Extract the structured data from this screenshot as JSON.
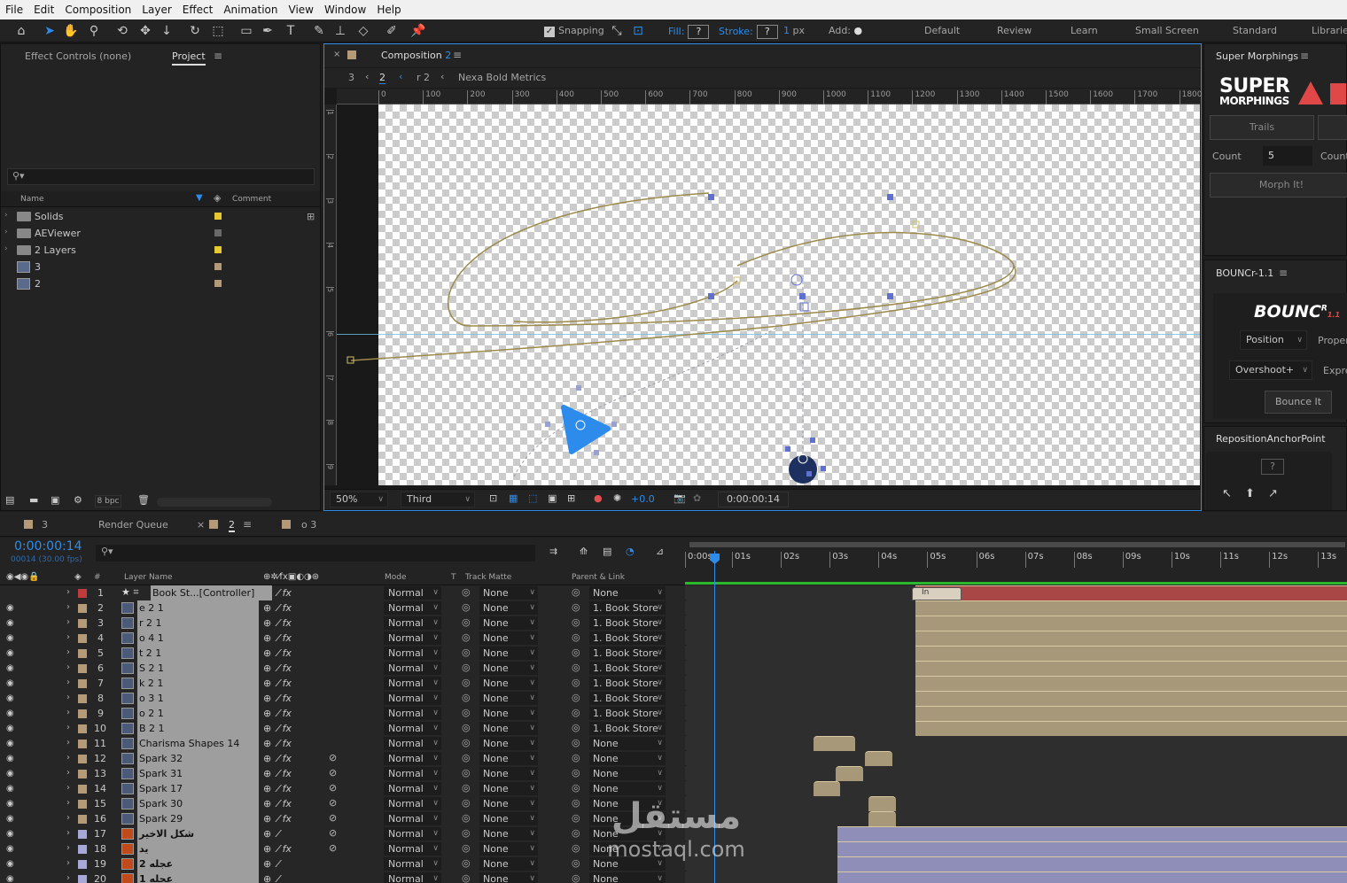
{
  "menu": [
    "File",
    "Edit",
    "Composition",
    "Layer",
    "Effect",
    "Animation",
    "View",
    "Window",
    "Help"
  ],
  "toolbar": {
    "snapping": "Snapping",
    "fill_label": "Fill:",
    "fill_value": "?",
    "stroke_label": "Stroke:",
    "stroke_value": "?",
    "stroke_width": "1",
    "stroke_unit": "px",
    "add_label": "Add:",
    "workspaces": [
      "Default",
      "Review",
      "Learn",
      "Small Screen",
      "Standard",
      "Libraries"
    ]
  },
  "project_panel": {
    "tab_effect_controls": "Effect Controls (none)",
    "tab_project": "Project",
    "col_name": "Name",
    "col_comment": "Comment",
    "items": [
      {
        "name": "Solids",
        "type": "folder",
        "label_color": "#e6c830"
      },
      {
        "name": "AEViewer",
        "type": "folder",
        "label_color": "#6a6a6a"
      },
      {
        "name": "2 Layers",
        "type": "folder",
        "label_color": "#e6c830"
      },
      {
        "name": "3",
        "type": "comp",
        "label_color": "#b59a78"
      },
      {
        "name": "2",
        "type": "comp",
        "label_color": "#b59a78"
      }
    ],
    "bpc": "8 bpc"
  },
  "composition": {
    "tab_label": "Composition",
    "tab_num": "2",
    "breadcrumbs": [
      "3",
      "2",
      "r 2",
      "Nexa Bold Metrics"
    ],
    "ruler_h": [
      "0",
      "100",
      "200",
      "300",
      "400",
      "500",
      "600",
      "700",
      "800",
      "900",
      "1000",
      "1100",
      "1200",
      "1300",
      "1400",
      "1500",
      "1600",
      "1700",
      "1800"
    ],
    "ruler_v": [
      "1",
      "2",
      "3",
      "4",
      "5",
      "6",
      "7",
      "8",
      "9"
    ],
    "zoom": "50%",
    "resolution": "Third",
    "exposure": "+0.0",
    "timecode": "0:00:00:14"
  },
  "super_morphings": {
    "title": "Super Morphings",
    "logo_line1": "SUPER",
    "logo_line2": "MORPHINGS",
    "trails_btn": "Trails",
    "count_label": "Count",
    "count_value": "5",
    "count_label2": "Count",
    "morph_btn": "Morph It!"
  },
  "bouncr": {
    "title": "BOUNCr-1.1",
    "logo": "BOUNC",
    "logo_sup": "R",
    "logo_ver": "1.1",
    "position_dd": "Position",
    "proper": "Proper",
    "overshoot_dd": "Overshoot+",
    "expre": "Expre",
    "bounce_btn": "Bounce It"
  },
  "reposition": {
    "title": "RepositionAnchorPoint",
    "q": "?"
  },
  "timeline": {
    "tabs": [
      {
        "label": "3",
        "color": "#b59a78"
      },
      {
        "label": "Render Queue"
      },
      {
        "label": "2",
        "color": "#b59a78"
      },
      {
        "label": "o 3",
        "color": "#b59a78"
      }
    ],
    "timecode": "0:00:00:14",
    "frames": "00014 (30.00 fps)",
    "col_layer_name": "Layer Name",
    "col_mode": "Mode",
    "col_t": "T",
    "col_track_matte": "Track Matte",
    "col_parent": "Parent & Link",
    "ruler": [
      "0:00s",
      "01s",
      "02s",
      "03s",
      "04s",
      "05s",
      "06s",
      "07s",
      "08s",
      "09s",
      "10s",
      "11s",
      "12s",
      "13s"
    ],
    "work_area_label": "In",
    "layers": [
      {
        "num": "1",
        "name": "Book St...[Controller]",
        "mode": "Normal",
        "matte": "None",
        "parent": "None",
        "color": "#c03c3c",
        "fx": true
      },
      {
        "num": "2",
        "name": "e 2 1",
        "mode": "Normal",
        "matte": "None",
        "parent": "1. Book Store",
        "color": "#b59a78",
        "fx": true
      },
      {
        "num": "3",
        "name": "r 2 1",
        "mode": "Normal",
        "matte": "None",
        "parent": "1. Book Store",
        "color": "#b59a78",
        "fx": true
      },
      {
        "num": "4",
        "name": "o 4 1",
        "mode": "Normal",
        "matte": "None",
        "parent": "1. Book Store",
        "color": "#b59a78",
        "fx": true
      },
      {
        "num": "5",
        "name": "t 2 1",
        "mode": "Normal",
        "matte": "None",
        "parent": "1. Book Store",
        "color": "#b59a78",
        "fx": true
      },
      {
        "num": "6",
        "name": "S 2 1",
        "mode": "Normal",
        "matte": "None",
        "parent": "1. Book Store",
        "color": "#b59a78",
        "fx": true
      },
      {
        "num": "7",
        "name": "k 2 1",
        "mode": "Normal",
        "matte": "None",
        "parent": "1. Book Store",
        "color": "#b59a78",
        "fx": true
      },
      {
        "num": "8",
        "name": "o 3 1",
        "mode": "Normal",
        "matte": "None",
        "parent": "1. Book Store",
        "color": "#b59a78",
        "fx": true
      },
      {
        "num": "9",
        "name": "o 2 1",
        "mode": "Normal",
        "matte": "None",
        "parent": "1. Book Store",
        "color": "#b59a78",
        "fx": true
      },
      {
        "num": "10",
        "name": "B 2 1",
        "mode": "Normal",
        "matte": "None",
        "parent": "1. Book Store",
        "color": "#b59a78",
        "fx": true
      },
      {
        "num": "11",
        "name": "Charisma Shapes 14",
        "mode": "Normal",
        "matte": "None",
        "parent": "None",
        "color": "#b59a78",
        "fx": true
      },
      {
        "num": "12",
        "name": "Spark 32",
        "mode": "Normal",
        "matte": "None",
        "parent": "None",
        "color": "#b59a78",
        "fx": true
      },
      {
        "num": "13",
        "name": "Spark 31",
        "mode": "Normal",
        "matte": "None",
        "parent": "None",
        "color": "#b59a78",
        "fx": true
      },
      {
        "num": "14",
        "name": "Spark 17",
        "mode": "Normal",
        "matte": "None",
        "parent": "None",
        "color": "#b59a78",
        "fx": true
      },
      {
        "num": "15",
        "name": "Spark 30",
        "mode": "Normal",
        "matte": "None",
        "parent": "None",
        "color": "#b59a78",
        "fx": true
      },
      {
        "num": "16",
        "name": "Spark 29",
        "mode": "Normal",
        "matte": "None",
        "parent": "None",
        "color": "#b59a78",
        "fx": true
      },
      {
        "num": "17",
        "name": "شكل الاخير",
        "mode": "Normal",
        "matte": "None",
        "parent": "None",
        "color": "#a8a8d8",
        "fx": false
      },
      {
        "num": "18",
        "name": "يد",
        "mode": "Normal",
        "matte": "None",
        "parent": "None",
        "color": "#a8a8d8",
        "fx": true
      },
      {
        "num": "19",
        "name": "عجله 2",
        "mode": "Normal",
        "matte": "None",
        "parent": "None",
        "color": "#a8a8d8",
        "fx": false
      },
      {
        "num": "20",
        "name": "عجله 1",
        "mode": "Normal",
        "matte": "None",
        "parent": "None",
        "color": "#a8a8d8",
        "fx": false
      }
    ]
  },
  "watermark": {
    "arabic": "مستقل",
    "latin": "mostaql.com"
  }
}
